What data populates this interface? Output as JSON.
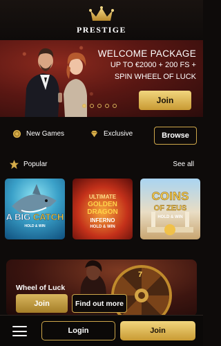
{
  "brand": {
    "name": "PRESTIGE",
    "accent": "#e4c26b"
  },
  "hero": {
    "title": "WELCOME PACKAGE",
    "line2": "UP TO €2000 + 200 FS +",
    "line3": "SPIN WHEEL OF LUCK",
    "join_label": "Join",
    "slides": 5,
    "active_slide": 1
  },
  "filters": {
    "new_games_label": "New Games",
    "exclusive_label": "Exclusive",
    "browse_label": "Browse"
  },
  "popular": {
    "title": "Popular",
    "see_all_label": "See all",
    "games": [
      {
        "title_a": "A BIG",
        "title_b": "CATCH",
        "subtitle": "HOLD & WIN"
      },
      {
        "title_a": "ULTIMATE",
        "title_b": "GOLDEN DRAGON",
        "title_c": "INFERNO",
        "subtitle": "HOLD & WIN"
      },
      {
        "title_a": "COINS",
        "title_b": "OF ZEUS",
        "subtitle": "HOLD & WIN"
      }
    ]
  },
  "wheel_promo": {
    "title": "Wheel of Luck",
    "join_label": "Join",
    "more_label": "Find out more",
    "wheel_number": "7"
  },
  "bottom_bar": {
    "login_label": "Login",
    "join_label": "Join"
  }
}
